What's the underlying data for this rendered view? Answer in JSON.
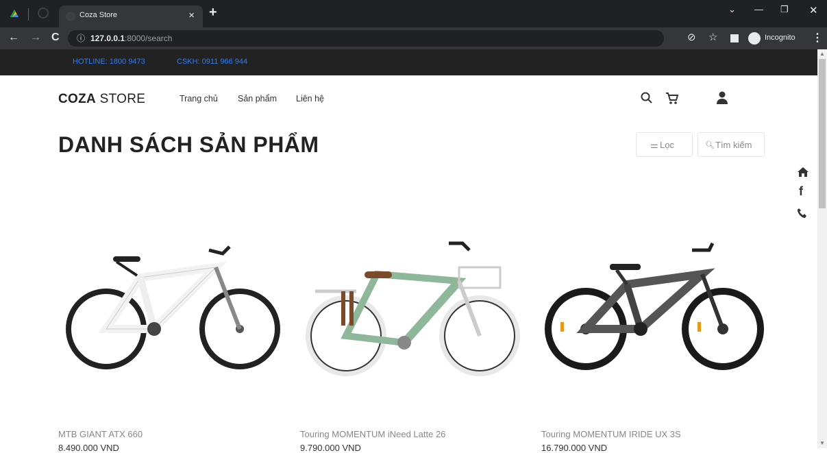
{
  "browser": {
    "tab_title": "Coza Store",
    "new_tab": "+",
    "url_host": "127.0.0.1",
    "url_rest": ":8000/search",
    "incognito_label": "Incognito"
  },
  "topbar": {
    "hotline": "HOTLINE: 1800 9473",
    "cskh": "CSKH: 0911 966 944"
  },
  "header": {
    "logo_bold": "COZA",
    "logo_light": " STORE",
    "menu": [
      "Trang chủ",
      "Sản phẩm",
      "Liên hệ"
    ]
  },
  "page": {
    "title": "DANH SÁCH SẢN PHẨM",
    "filter_label": "Lọc",
    "search_label": "Tìm kiếm"
  },
  "products": [
    {
      "name": "MTB GIANT ATX 660",
      "price": "8.490.000 VND",
      "frame_color": "#f2f2f2"
    },
    {
      "name": "Touring MOMENTUM iNeed Latte 26",
      "price": "9.790.000 VND",
      "frame_color": "#8fb79a"
    },
    {
      "name": "Touring MOMENTUM IRIDE UX 3S",
      "price": "16.790.000 VND",
      "frame_color": "#555555"
    }
  ],
  "colors": {
    "accent_link": "#2f7df6",
    "dark_bar": "#222222"
  }
}
